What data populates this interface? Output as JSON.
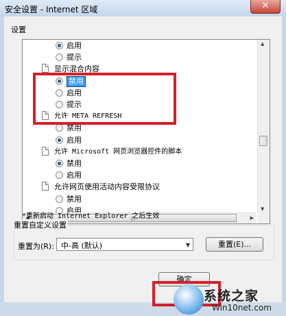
{
  "window": {
    "title": "安全设置 - Internet 区域",
    "close_glyph": "✕"
  },
  "settings_label": "设置",
  "tree": [
    {
      "type": "radio",
      "label": "启用",
      "checked": true
    },
    {
      "type": "radio",
      "label": "提示",
      "checked": false
    },
    {
      "type": "heading",
      "label": "显示混合内容"
    },
    {
      "type": "radio",
      "label": "禁用",
      "checked": true,
      "highlighted": true
    },
    {
      "type": "radio",
      "label": "启用",
      "checked": false
    },
    {
      "type": "radio",
      "label": "提示",
      "checked": false
    },
    {
      "type": "heading",
      "label": "允许 META REFRESH"
    },
    {
      "type": "radio",
      "label": "禁用",
      "checked": false
    },
    {
      "type": "radio",
      "label": "启用",
      "checked": true
    },
    {
      "type": "heading",
      "label": "允许 Microsoft 网页浏览器控件的脚本"
    },
    {
      "type": "radio",
      "label": "禁用",
      "checked": true
    },
    {
      "type": "radio",
      "label": "启用",
      "checked": false
    },
    {
      "type": "heading",
      "label": "允许网页使用活动内容受限协议"
    },
    {
      "type": "radio",
      "label": "禁用",
      "checked": false
    },
    {
      "type": "radio",
      "label": "启用",
      "checked": false
    }
  ],
  "restart_note": "*重新启动 Internet Explorer 之后生效",
  "reset_group": {
    "title": "重置自定义设置",
    "reset_to_label": "重置为(R):",
    "selected_level": "中-高 (默认)",
    "reset_button": "重置(E)..."
  },
  "ok_button": "确定",
  "watermark": {
    "text1": "系统之家",
    "text2": "Win10net.com"
  }
}
